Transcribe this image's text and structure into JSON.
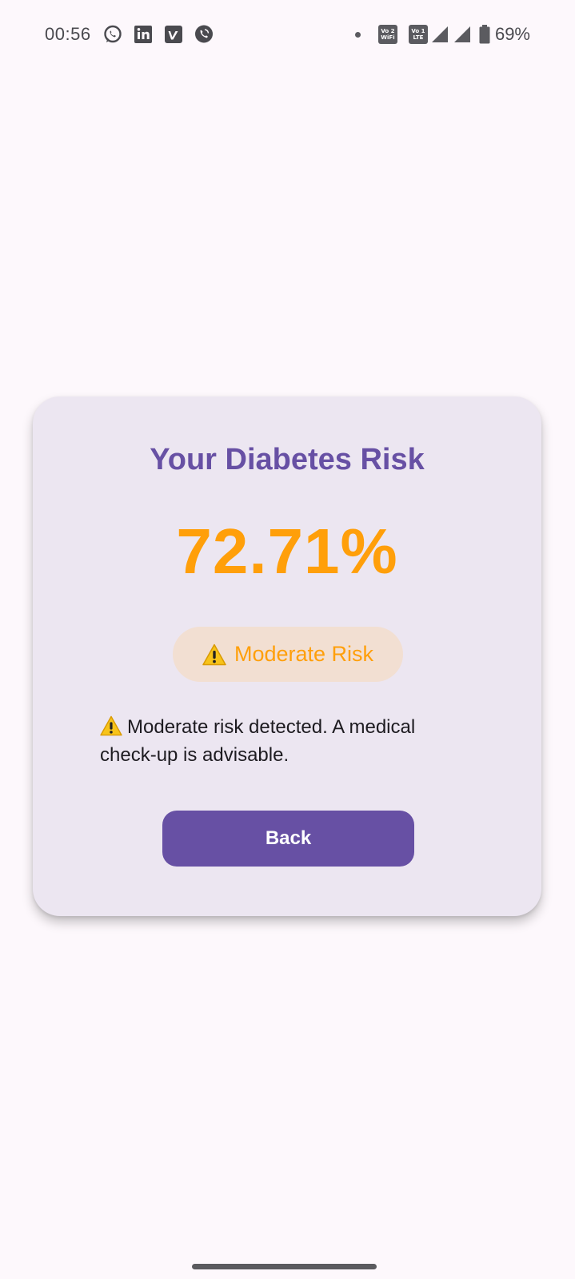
{
  "status_bar": {
    "time": "00:56",
    "notification_icons": [
      "whatsapp-icon",
      "linkedin-icon",
      "vimeo-icon",
      "viber-icon"
    ],
    "wifi_badge_top": "Vo 2",
    "wifi_badge_bottom": "WiFi",
    "lte_badge_top": "Vo 1",
    "lte_badge_bottom": "LTE",
    "battery_percent": "69%"
  },
  "result": {
    "title": "Your Diabetes Risk",
    "percentage": "72.71%",
    "risk_label": "Moderate Risk",
    "message": "Moderate risk detected. A medical check-up is advisable.",
    "back_label": "Back"
  },
  "colors": {
    "primary": "#6750a4",
    "risk_orange": "#ff9f0a",
    "card_bg": "#ece6f1",
    "chip_bg": "#f2dfd2",
    "page_bg": "#fdf8fc"
  }
}
